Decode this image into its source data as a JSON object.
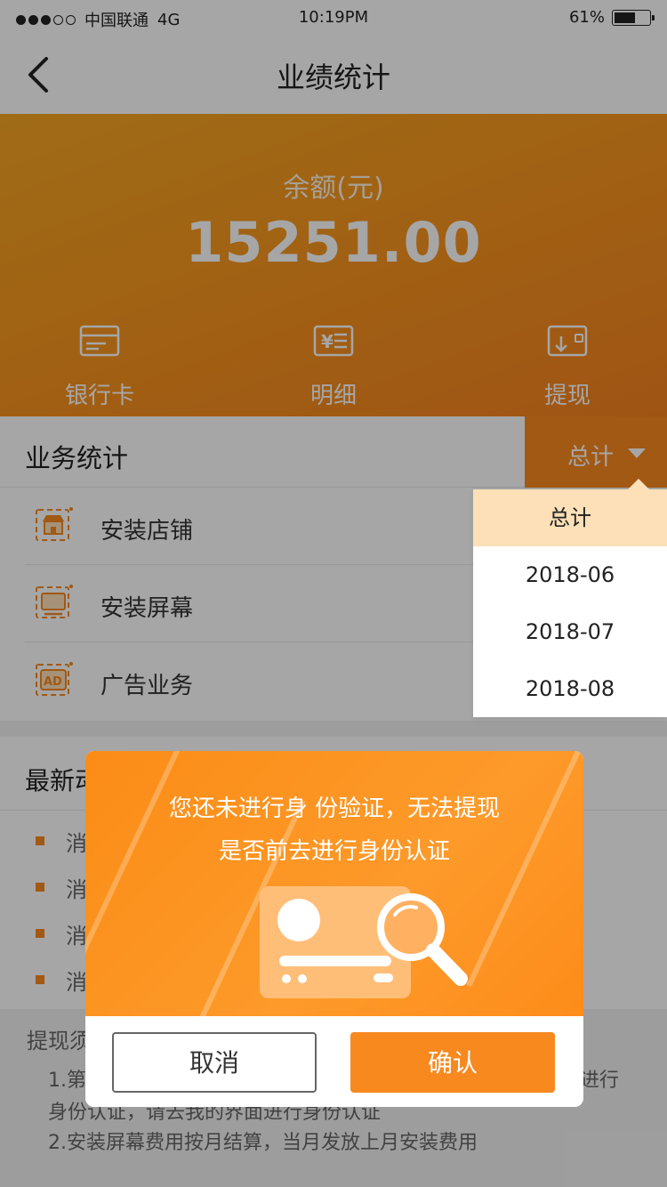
{
  "status_bar": {
    "carrier": "中国联通",
    "network": "4G",
    "time": "10:19PM",
    "battery": "61%",
    "battery_level": 0.61
  },
  "nav": {
    "title": "业绩统计",
    "back_icon": "chevron-left-icon"
  },
  "balance": {
    "label": "余额(元)",
    "amount": "15251.00"
  },
  "actions": [
    {
      "label": "银行卡",
      "icon": "bank-card-icon"
    },
    {
      "label": "明细",
      "icon": "detail-list-icon"
    },
    {
      "label": "提现",
      "icon": "withdraw-icon"
    }
  ],
  "stats": {
    "title": "业务统计",
    "filter_label": "总计",
    "items": [
      {
        "label": "安装店铺",
        "icon": "store-icon"
      },
      {
        "label": "安装屏幕",
        "icon": "screen-icon"
      },
      {
        "label": "广告业务",
        "icon": "ad-icon"
      }
    ]
  },
  "dropdown": {
    "options": [
      "总计",
      "2018-06",
      "2018-07",
      "2018-08"
    ],
    "selected": "总计"
  },
  "news": {
    "title": "最新动",
    "items": [
      "消",
      "消",
      "消",
      "消"
    ]
  },
  "notes": {
    "title": "提现须",
    "line1a": "1.第",
    "line1b": "进行",
    "line1c": "身份认证，请去我的界面进行身份认证",
    "line2": "2.安装屏幕费用按月结算，当月发放上月安装费用"
  },
  "modal": {
    "message_line1": "您还未进行身 份验证，无法提现",
    "message_line2": "是否前去进行身份认证",
    "illustration": "id-card-search-icon",
    "cancel_label": "取消",
    "confirm_label": "确认"
  },
  "colors": {
    "accent": "#f7891f",
    "dropdown_selected": "#fde0b8"
  }
}
